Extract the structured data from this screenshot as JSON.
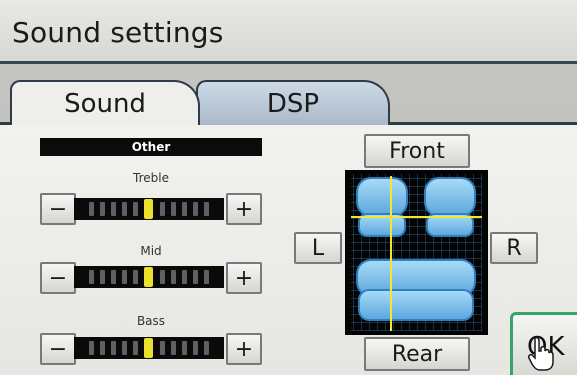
{
  "window": {
    "title": "Sound settings"
  },
  "tabs": [
    {
      "label": "Sound",
      "active": true
    },
    {
      "label": "DSP",
      "active": false
    }
  ],
  "other_section": {
    "header": "Other",
    "sliders": [
      {
        "label": "Treble",
        "minus": "−",
        "plus": "+",
        "level_fraction": 0.5
      },
      {
        "label": "Mid",
        "minus": "−",
        "plus": "+",
        "level_fraction": 0.5
      },
      {
        "label": "Bass",
        "minus": "−",
        "plus": "+",
        "level_fraction": 0.5
      }
    ]
  },
  "balance": {
    "front": "Front",
    "rear": "Rear",
    "left": "L",
    "right": "R"
  },
  "ok_button": "OK",
  "colors": {
    "accent_yellow": "#e9e12c",
    "seat_blue": "#7fc4ec",
    "ok_border": "#35a36a",
    "tab_blue": "#aab9c9"
  }
}
